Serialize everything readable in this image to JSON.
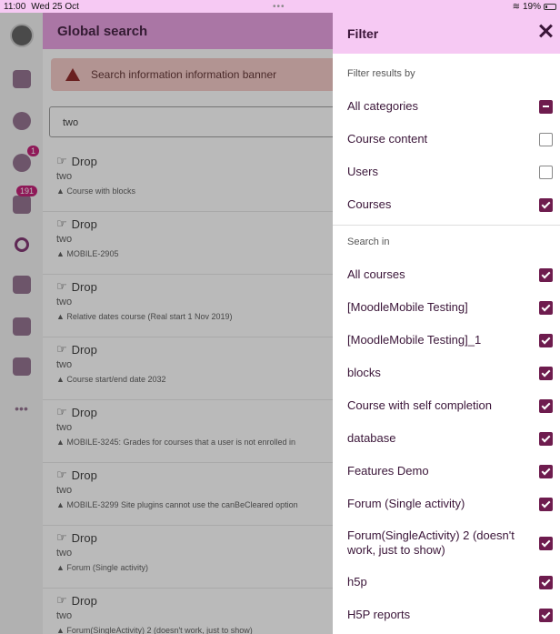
{
  "status": {
    "time": "11:00",
    "date": "Wed 25 Oct",
    "battery": "19%"
  },
  "page": {
    "title": "Global search",
    "banner": "Search information information banner",
    "search_value": "two"
  },
  "sidebar": {
    "messages_badge": "1",
    "notifications_badge": "191"
  },
  "results": [
    {
      "title": "Drop",
      "subtitle": "two",
      "context": "Course with blocks"
    },
    {
      "title": "Drop",
      "subtitle": "two",
      "context": "MOBILE-2905"
    },
    {
      "title": "Drop",
      "subtitle": "two",
      "context": "Relative dates course (Real start 1 Nov 2019)"
    },
    {
      "title": "Drop",
      "subtitle": "two",
      "context": "Course start/end date 2032"
    },
    {
      "title": "Drop",
      "subtitle": "two",
      "context": "MOBILE-3245: Grades for courses that a user is not enrolled in"
    },
    {
      "title": "Drop",
      "subtitle": "two",
      "context": "MOBILE-3299 Site plugins cannot use the canBeCleared option"
    },
    {
      "title": "Drop",
      "subtitle": "two",
      "context": "Forum (Single activity)"
    },
    {
      "title": "Drop",
      "subtitle": "two",
      "context": "Forum(SingleActivity) 2 (doesn't work, just to show)"
    }
  ],
  "filter": {
    "title": "Filter",
    "results_by_label": "Filter results by",
    "results_by": [
      {
        "label": "All categories",
        "state": "indeterminate"
      },
      {
        "label": "Course content",
        "state": "unchecked"
      },
      {
        "label": "Users",
        "state": "unchecked"
      },
      {
        "label": "Courses",
        "state": "checked"
      }
    ],
    "search_in_label": "Search in",
    "search_in": [
      {
        "label": "All courses",
        "state": "checked"
      },
      {
        "label": "[MoodleMobile Testing]",
        "state": "checked"
      },
      {
        "label": "[MoodleMobile Testing]_1",
        "state": "checked"
      },
      {
        "label": "blocks",
        "state": "checked"
      },
      {
        "label": "Course with self completion",
        "state": "checked"
      },
      {
        "label": "database",
        "state": "checked"
      },
      {
        "label": "Features Demo",
        "state": "checked"
      },
      {
        "label": "Forum (Single activity)",
        "state": "checked"
      },
      {
        "label": "Forum(SingleActivity) 2 (doesn't work, just to show)",
        "state": "checked"
      },
      {
        "label": "h5p",
        "state": "checked"
      },
      {
        "label": "H5P reports",
        "state": "checked"
      }
    ]
  }
}
